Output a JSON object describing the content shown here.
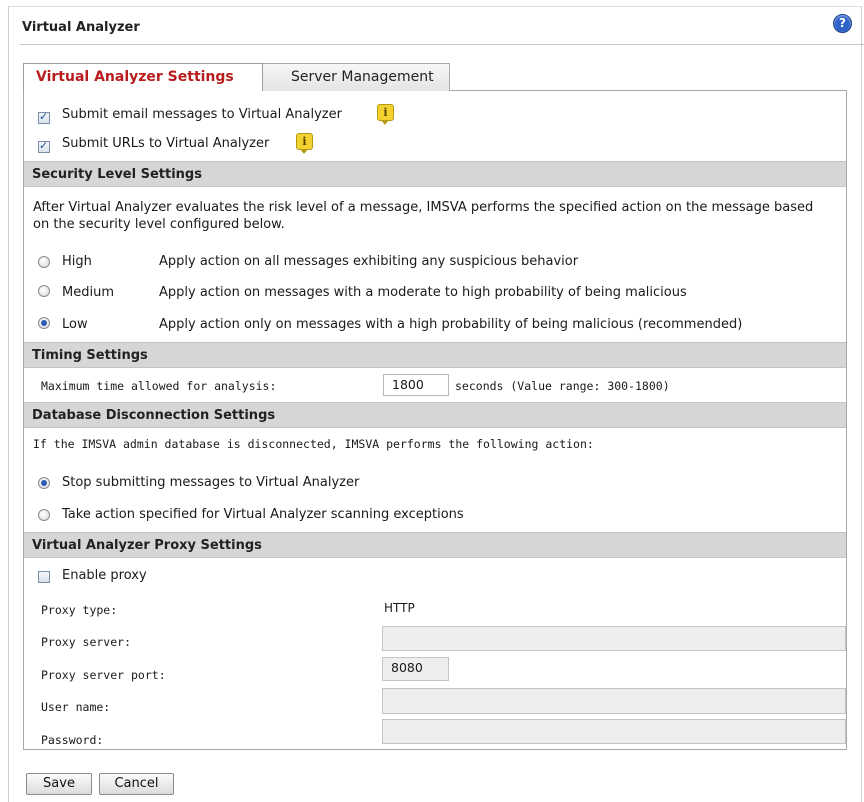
{
  "header": {
    "title": "Virtual Analyzer",
    "help_icon": "help-icon"
  },
  "tabs": [
    {
      "label": "Virtual Analyzer Settings",
      "active": true
    },
    {
      "label": "Server Management",
      "active": false
    }
  ],
  "submit": {
    "email_label": "Submit email messages to Virtual Analyzer",
    "email_checked": true,
    "urls_label": "Submit URLs to Virtual Analyzer",
    "urls_checked": true,
    "info_icon": "i"
  },
  "security": {
    "heading": "Security Level Settings",
    "description": "After Virtual Analyzer evaluates the risk level of a message, IMSVA performs the specified action on the message based on the security level configured below.",
    "levels": [
      {
        "label": "High",
        "desc": "Apply action on all messages exhibiting any suspicious behavior",
        "selected": false
      },
      {
        "label": "Medium",
        "desc": "Apply action on messages with a moderate to high probability of being malicious",
        "selected": false
      },
      {
        "label": "Low",
        "desc": "Apply action only on messages with a high probability of being malicious (recommended)",
        "selected": true
      }
    ]
  },
  "timing": {
    "heading": "Timing Settings",
    "label": "Maximum time allowed for analysis:",
    "value": "1800",
    "suffix": "seconds (Value range: 300-1800)"
  },
  "database": {
    "heading": "Database Disconnection Settings",
    "description": "If the IMSVA admin database is disconnected, IMSVA performs the following action:",
    "options": [
      {
        "label": "Stop submitting messages to Virtual Analyzer",
        "selected": true
      },
      {
        "label": "Take action specified for Virtual Analyzer scanning exceptions",
        "selected": false
      }
    ]
  },
  "proxy": {
    "heading": "Virtual Analyzer Proxy Settings",
    "enable_label": "Enable proxy",
    "enabled": false,
    "type_label": "Proxy type:",
    "type_value": "HTTP",
    "server_label": "Proxy server:",
    "server_value": "",
    "port_label": "Proxy server port:",
    "port_value": "8080",
    "user_label": "User name:",
    "user_value": "",
    "password_label": "Password:",
    "password_value": ""
  },
  "buttons": {
    "save": "Save",
    "cancel": "Cancel"
  }
}
